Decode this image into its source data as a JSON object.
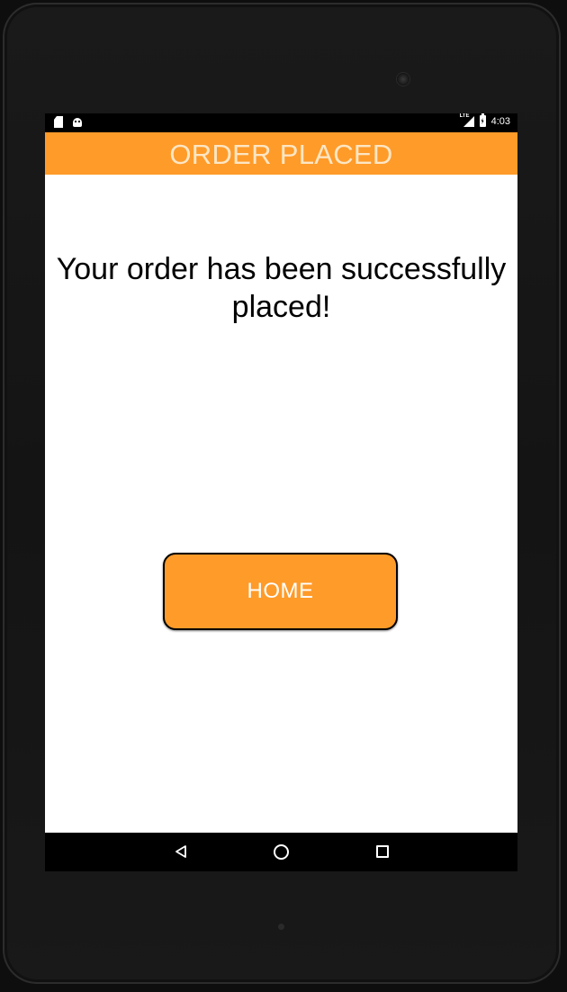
{
  "status_bar": {
    "network_label": "LTE",
    "time": "4:03",
    "left_icons": [
      "sd-card-icon",
      "android-debug-icon"
    ],
    "right_icons": [
      "signal-icon",
      "battery-charging-icon"
    ]
  },
  "app_bar": {
    "title": "ORDER PLACED",
    "background_color": "#ff9b29",
    "title_color": "#fde6c4"
  },
  "main": {
    "message": "Your order has been successfully placed!",
    "home_button_label": "HOME",
    "button_color": "#ff9b29"
  },
  "nav_bar": {
    "icons": [
      "back-icon",
      "home-circle-icon",
      "recent-apps-icon"
    ]
  }
}
